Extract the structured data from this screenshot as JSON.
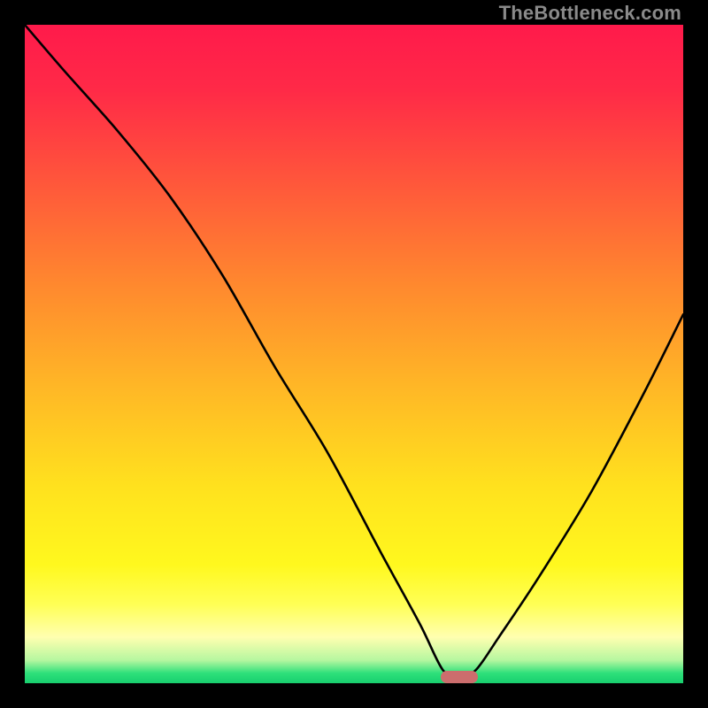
{
  "watermark": {
    "text": "TheBottleneck.com"
  },
  "marker": {
    "x_pct": 66,
    "y_pct": 99.1,
    "color": "#cc6d6d"
  },
  "gradient": {
    "stops": [
      {
        "offset": 0.0,
        "color": "#ff1a4b"
      },
      {
        "offset": 0.1,
        "color": "#ff2a47"
      },
      {
        "offset": 0.25,
        "color": "#ff5a3a"
      },
      {
        "offset": 0.4,
        "color": "#ff8a2e"
      },
      {
        "offset": 0.55,
        "color": "#ffb726"
      },
      {
        "offset": 0.7,
        "color": "#ffe11e"
      },
      {
        "offset": 0.82,
        "color": "#fff81e"
      },
      {
        "offset": 0.88,
        "color": "#ffff55"
      },
      {
        "offset": 0.93,
        "color": "#ffffb0"
      },
      {
        "offset": 0.965,
        "color": "#b6f7a0"
      },
      {
        "offset": 0.985,
        "color": "#2de07a"
      },
      {
        "offset": 1.0,
        "color": "#18cf6e"
      }
    ]
  },
  "chart_data": {
    "type": "line",
    "title": "",
    "xlabel": "",
    "ylabel": "",
    "xlim": [
      0,
      100
    ],
    "ylim": [
      0,
      100
    ],
    "grid": false,
    "series": [
      {
        "name": "bottleneck-curve",
        "x": [
          0,
          6,
          14,
          22,
          30,
          38,
          46,
          54,
          60,
          63.5,
          66,
          68.5,
          72,
          78,
          86,
          94,
          100
        ],
        "y": [
          100,
          93,
          84,
          74,
          62,
          48,
          35,
          20,
          9,
          2,
          1,
          2,
          7,
          16,
          29,
          44,
          56
        ]
      }
    ],
    "annotations": [
      {
        "type": "pill",
        "x": 66,
        "y": 1,
        "color": "#cc6d6d",
        "meaning": "optimal-point"
      }
    ]
  }
}
